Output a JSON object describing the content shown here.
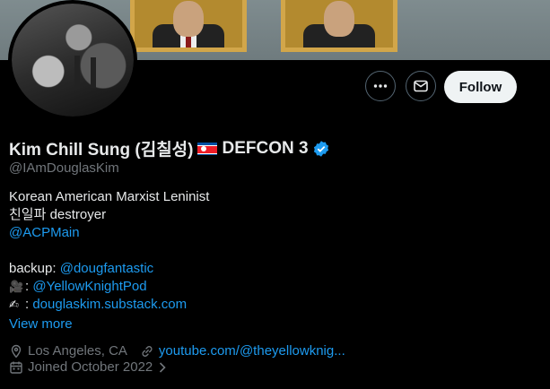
{
  "profile": {
    "display_name_prefix": "Kim Chill Sung (김칠성)",
    "display_name_suffix": "DEFCON 3",
    "flag_icon": "north-korea-flag",
    "verified_icon": "verified-badge-icon",
    "handle": "@IAmDouglasKim"
  },
  "actions": {
    "more_icon": "more-icon",
    "message_icon": "message-icon",
    "follow_label": "Follow"
  },
  "bio": {
    "line1": "Korean American Marxist Leninist",
    "line2": "친일파 destroyer",
    "line3_link": "@ACPMain",
    "backup_label": "backup:",
    "backup_link": "@dougfantastic",
    "camera_emoji": "🎥",
    "camera_sep": ":",
    "camera_link": "@YellowKnightPod",
    "writing_emoji": "✍",
    "writing_sep": ":",
    "writing_link": "douglaskim.substack.com",
    "view_more": "View more"
  },
  "meta": {
    "location": "Los Angeles, CA",
    "website": "youtube.com/@theyellowknig...",
    "joined": "Joined October 2022"
  },
  "colors": {
    "background": "#000000",
    "accent": "#1d9bf0",
    "muted": "#71767b",
    "follow_bg": "#eff3f4"
  }
}
